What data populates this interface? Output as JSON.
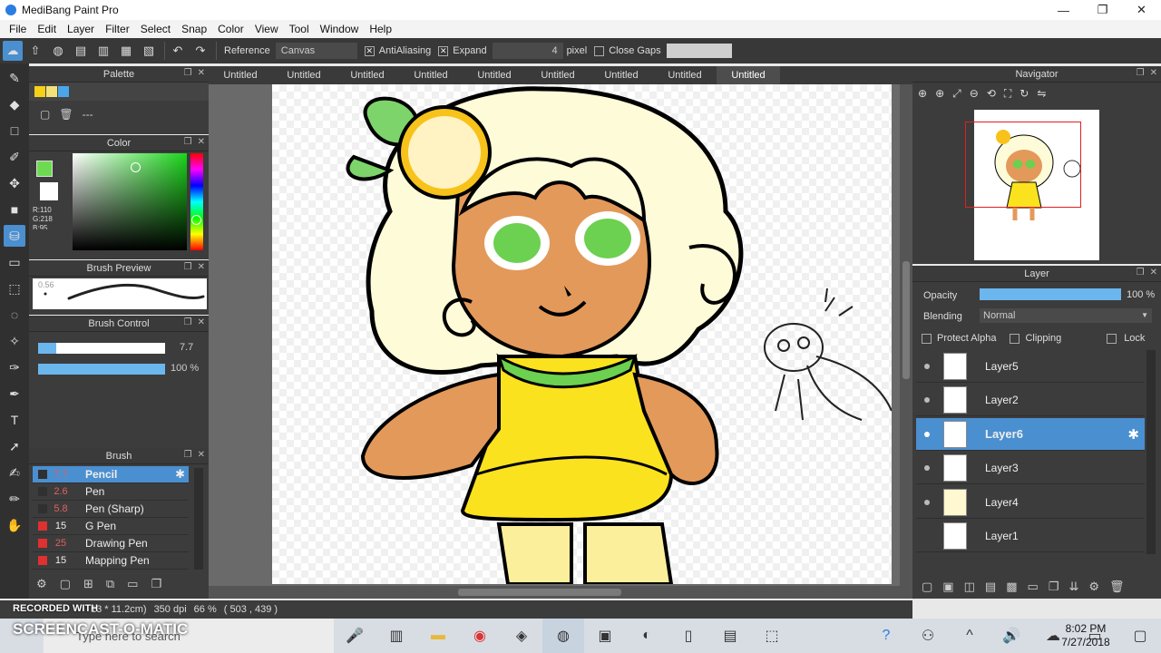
{
  "window": {
    "title": "MediBang Paint Pro",
    "minimize": "—",
    "maximize": "❐",
    "close": "✕"
  },
  "menu": [
    "File",
    "Edit",
    "Layer",
    "Filter",
    "Select",
    "Snap",
    "Color",
    "View",
    "Tool",
    "Window",
    "Help"
  ],
  "toolbar": {
    "reference_label": "Reference",
    "reference_value": "Canvas",
    "antialiasing_label": "AntiAliasing",
    "expand_label": "Expand",
    "expand_value": "4",
    "expand_unit": "pixel",
    "close_gaps_label": "Close Gaps"
  },
  "palette": {
    "title": "Palette",
    "swatches": [
      "#f7d117",
      "#f3e27a",
      "#4aa6e8"
    ],
    "dash": "---"
  },
  "color": {
    "title": "Color",
    "current": "#6eda52",
    "r_label": "R:110",
    "g_label": "G:218",
    "b_label": "B:95"
  },
  "brush_preview": {
    "title": "Brush Preview",
    "size_label": "0.56"
  },
  "brush_control": {
    "title": "Brush Control",
    "size": "7.7",
    "opacity": "100 %",
    "opacity_value": 100
  },
  "brush": {
    "title": "Brush",
    "items": [
      {
        "size": "7.7",
        "name": "Pencil",
        "color": "#303030",
        "selected": true
      },
      {
        "size": "2.6",
        "name": "Pen",
        "color": "#303030"
      },
      {
        "size": "5.8",
        "name": "Pen (Sharp)",
        "color": "#303030"
      },
      {
        "size": "15",
        "name": "G Pen",
        "color": "#e03030"
      },
      {
        "size": "25",
        "name": "Drawing Pen",
        "color": "#e03030"
      },
      {
        "size": "15",
        "name": "Mapping Pen",
        "color": "#e03030"
      }
    ]
  },
  "tabs": [
    "Untitled",
    "Untitled",
    "Untitled",
    "Untitled",
    "Untitled",
    "Untitled",
    "Untitled",
    "Untitled",
    "Untitled"
  ],
  "navigator": {
    "title": "Navigator"
  },
  "layer": {
    "title": "Layer",
    "opacity_label": "Opacity",
    "opacity": "100 %",
    "opacity_value": 100,
    "blending_label": "Blending",
    "blending_value": "Normal",
    "protect_alpha": "Protect Alpha",
    "clipping": "Clipping",
    "lock": "Lock",
    "layers": [
      {
        "name": "Layer5",
        "selected": false
      },
      {
        "name": "Layer2",
        "selected": false
      },
      {
        "name": "Layer6",
        "selected": true
      },
      {
        "name": "Layer3",
        "selected": false
      },
      {
        "name": "Layer4",
        "selected": false
      },
      {
        "name": "Layer1",
        "selected": false
      }
    ]
  },
  "status": {
    "size": "13 * 11.2cm)",
    "dpi": "350 dpi",
    "zoom": "66 %",
    "coords": "( 503 , 439 )",
    "watermark_top": "RECORDED WITH",
    "watermark": "SCREENCAST-O-MATIC"
  },
  "taskbar": {
    "search_placeholder": "Type here to search",
    "time": "8:02 PM",
    "date": "7/27/2018"
  }
}
